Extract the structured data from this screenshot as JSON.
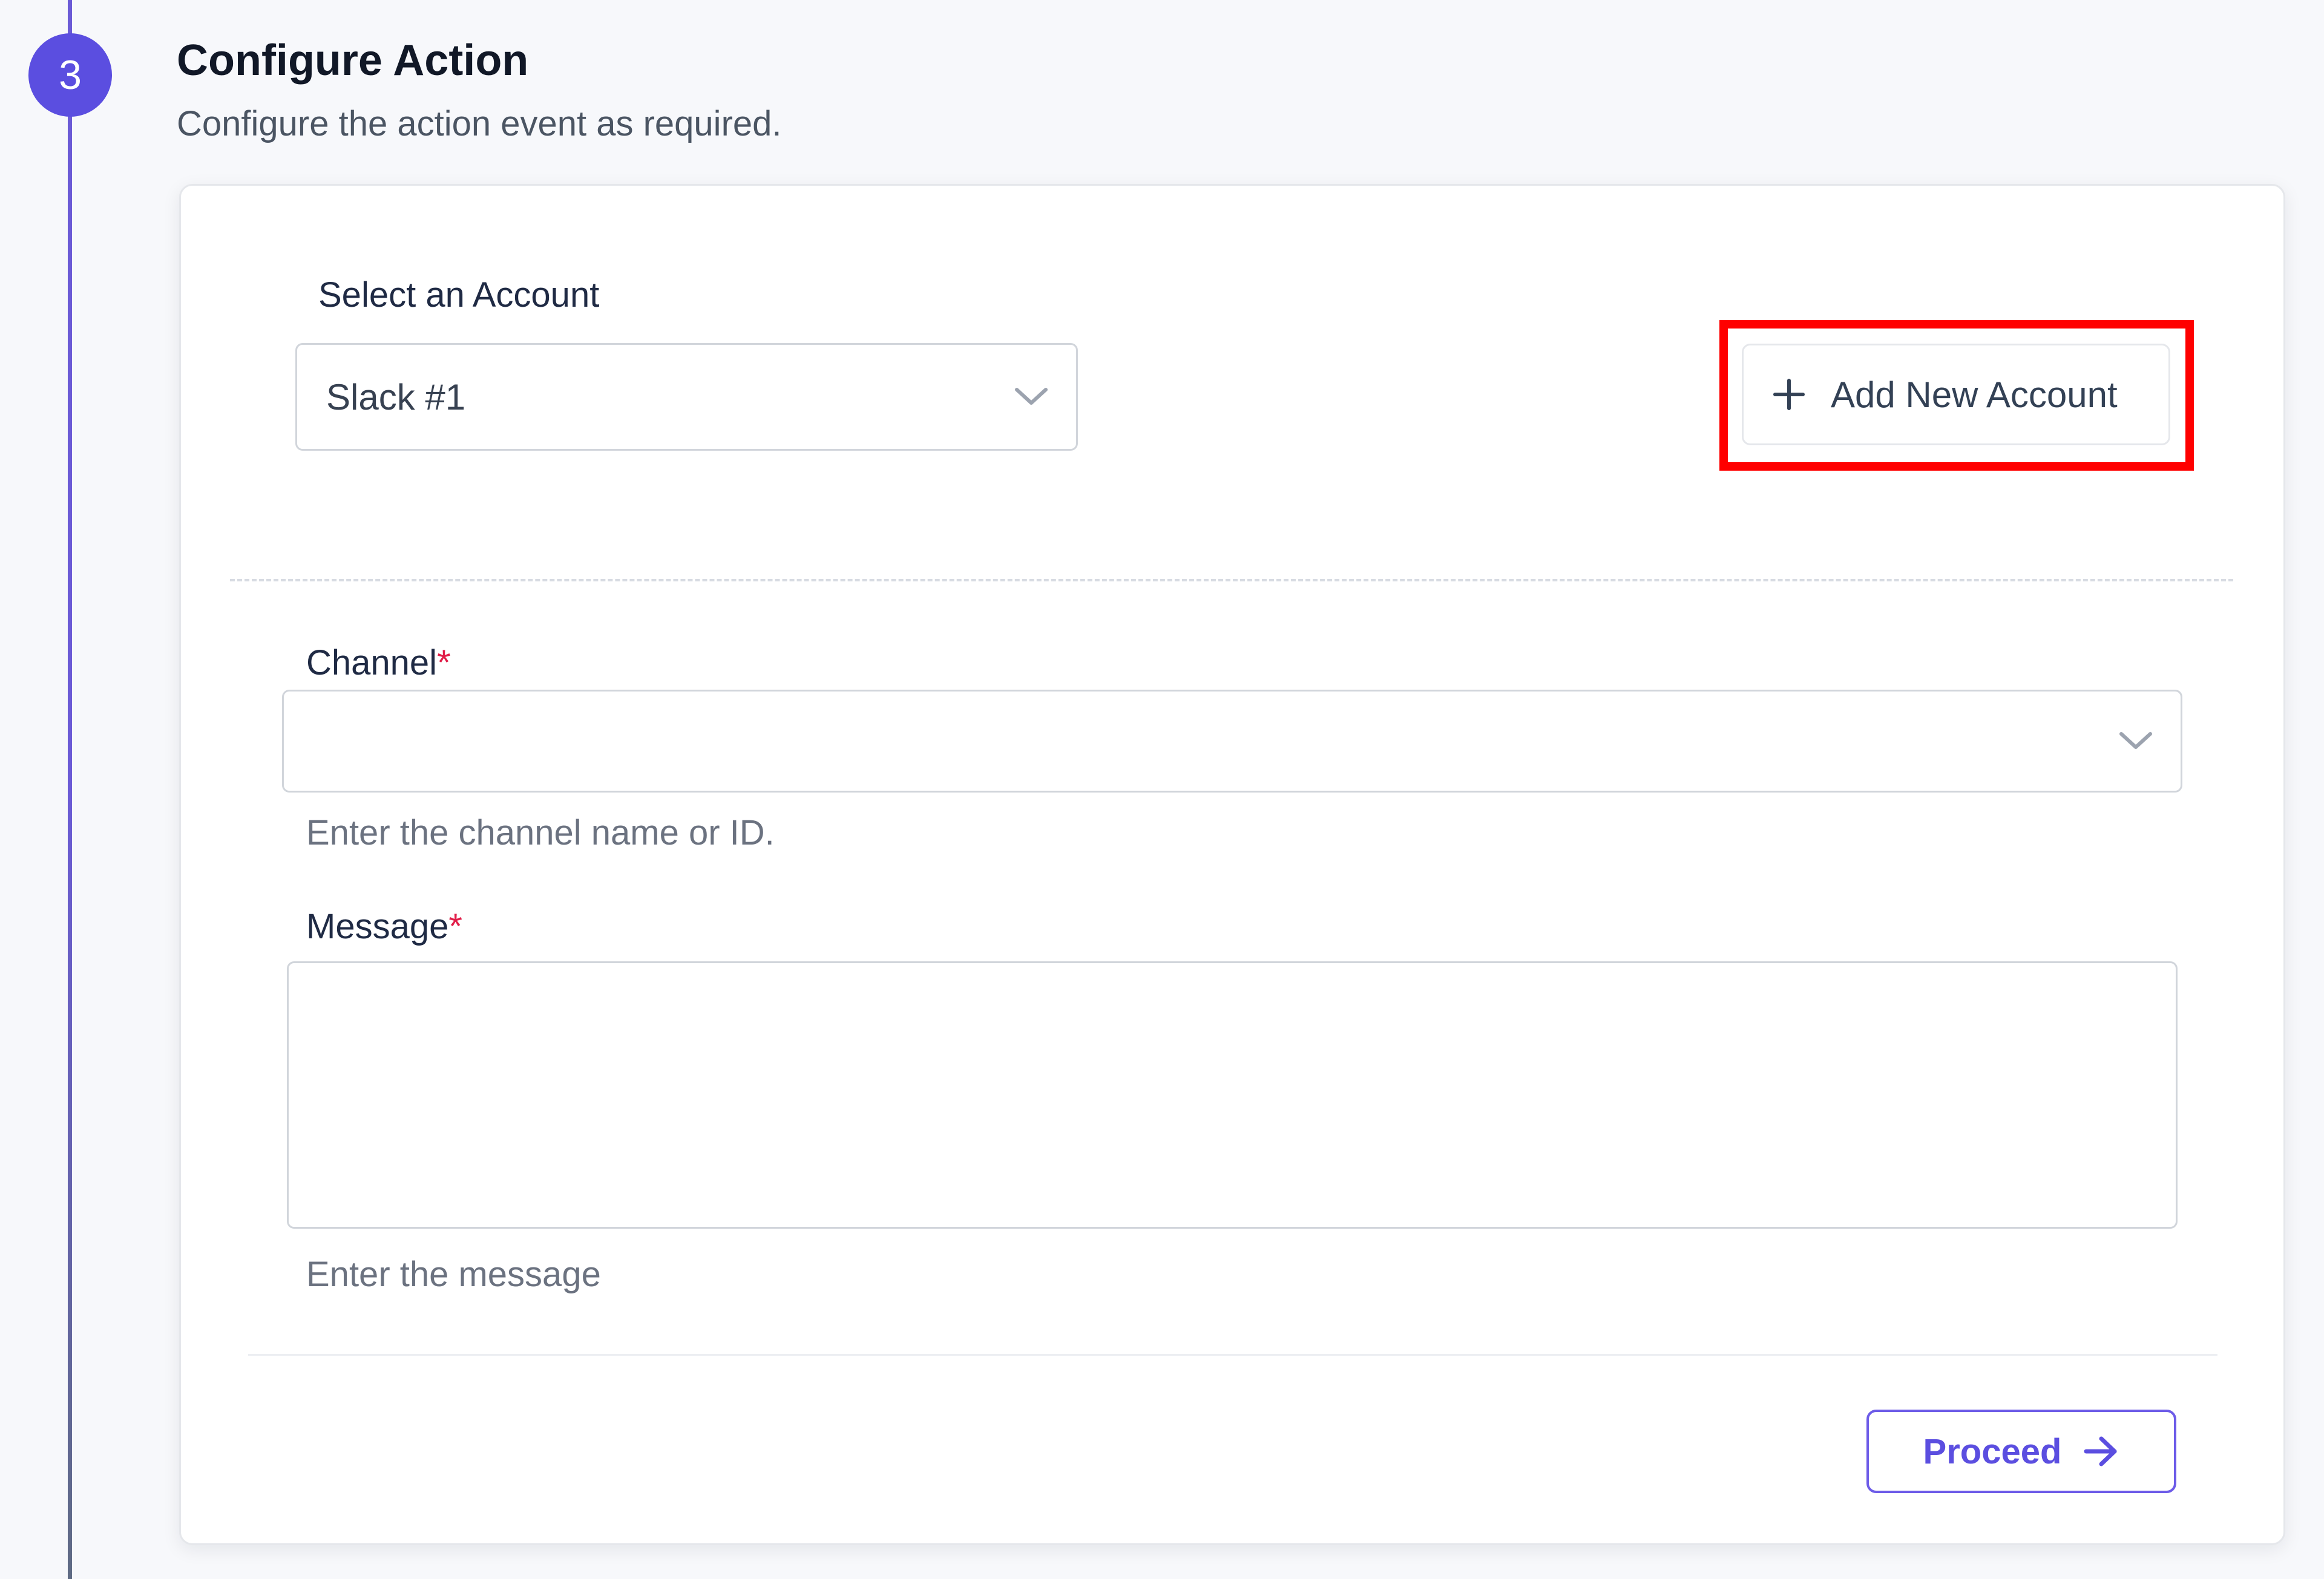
{
  "step": {
    "number": "3",
    "title": "Configure Action",
    "subtitle": "Configure the action event as required."
  },
  "account": {
    "label": "Select an Account",
    "selected": "Slack #1",
    "add_button_label": "Add New Account"
  },
  "channel": {
    "label": "Channel",
    "required_mark": "*",
    "value": "",
    "help": "Enter the channel name or ID."
  },
  "message": {
    "label": "Message",
    "required_mark": "*",
    "value": "",
    "help": "Enter the message"
  },
  "footer": {
    "proceed_label": "Proceed"
  },
  "colors": {
    "accent": "#5b4ee0",
    "highlight": "#ff0000",
    "required": "#e11d48"
  },
  "icons": {
    "select_chevron": "chevron-down-icon",
    "add_account": "plus-icon",
    "proceed": "arrow-right-icon"
  }
}
